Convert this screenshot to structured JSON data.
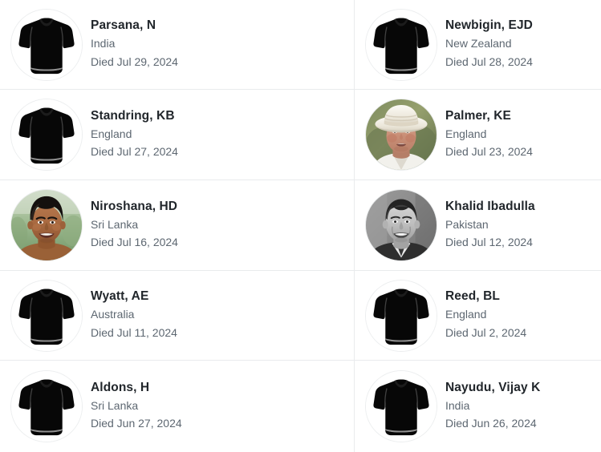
{
  "list": {
    "died_prefix": "Died",
    "columns": 2,
    "people": [
      {
        "name": "Parsana, N",
        "country": "India",
        "died": "Died Jul 29, 2024",
        "avatar": "shirt-placeholder-icon",
        "avatar_type": "placeholder"
      },
      {
        "name": "Newbigin, EJD",
        "country": "New Zealand",
        "died": "Died Jul 28, 2024",
        "avatar": "shirt-placeholder-icon",
        "avatar_type": "placeholder"
      },
      {
        "name": "Standring, KB",
        "country": "England",
        "died": "Died Jul 27, 2024",
        "avatar": "shirt-placeholder-icon",
        "avatar_type": "placeholder"
      },
      {
        "name": "Palmer, KE",
        "country": "England",
        "died": "Died Jul 23, 2024",
        "avatar": "portrait-photo",
        "avatar_type": "photo-hat"
      },
      {
        "name": "Niroshana, HD",
        "country": "Sri Lanka",
        "died": "Died Jul 16, 2024",
        "avatar": "portrait-photo",
        "avatar_type": "photo-color"
      },
      {
        "name": "Khalid Ibadulla",
        "country": "Pakistan",
        "died": "Died Jul 12, 2024",
        "avatar": "portrait-photo",
        "avatar_type": "photo-bw"
      },
      {
        "name": "Wyatt, AE",
        "country": "Australia",
        "died": "Died Jul 11, 2024",
        "avatar": "shirt-placeholder-icon",
        "avatar_type": "placeholder"
      },
      {
        "name": "Reed, BL",
        "country": "England",
        "died": "Died Jul 2, 2024",
        "avatar": "shirt-placeholder-icon",
        "avatar_type": "placeholder"
      },
      {
        "name": "Aldons, H",
        "country": "Sri Lanka",
        "died": "Died Jun 27, 2024",
        "avatar": "shirt-placeholder-icon",
        "avatar_type": "placeholder"
      },
      {
        "name": "Nayudu, Vijay K",
        "country": "India",
        "died": "Died Jun 26, 2024",
        "avatar": "shirt-placeholder-icon",
        "avatar_type": "placeholder"
      }
    ]
  },
  "colors": {
    "name_text": "#21262b",
    "meta_text": "#5d6771",
    "divider": "#e9ebed",
    "background": "#ffffff",
    "placeholder_shirt": "#0b0b0b"
  }
}
